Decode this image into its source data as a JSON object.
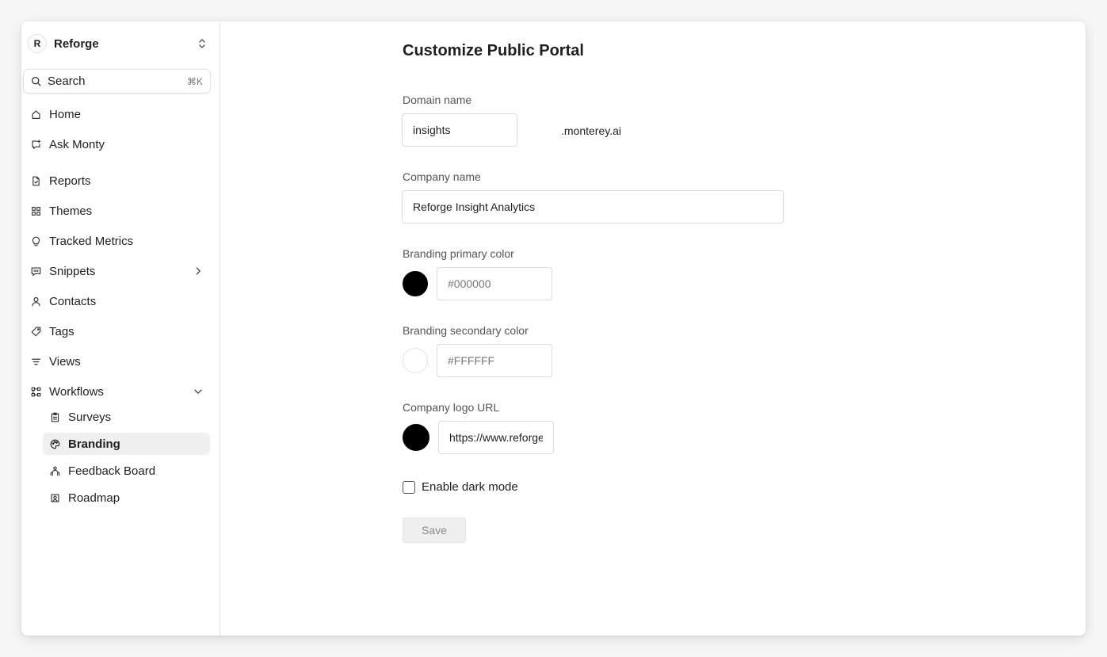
{
  "workspace": {
    "initial": "R",
    "name": "Reforge"
  },
  "search": {
    "label": "Search",
    "shortcut": "⌘K"
  },
  "nav": {
    "home": "Home",
    "ask_monty": "Ask Monty",
    "reports": "Reports",
    "themes": "Themes",
    "tracked_metrics": "Tracked Metrics",
    "snippets": "Snippets",
    "contacts": "Contacts",
    "tags": "Tags",
    "views": "Views",
    "workflows": "Workflows",
    "workflows_children": {
      "surveys": "Surveys",
      "branding": "Branding",
      "feedback_board": "Feedback Board",
      "roadmap": "Roadmap"
    },
    "active_item": "Branding"
  },
  "form": {
    "title": "Customize Public Portal",
    "domain": {
      "label": "Domain name",
      "value": "insights",
      "suffix": ".monterey.ai"
    },
    "company_name": {
      "label": "Company name",
      "value": "Reforge Insight Analytics"
    },
    "primary_color": {
      "label": "Branding primary color",
      "value": "#000000",
      "swatch": "#000000"
    },
    "secondary_color": {
      "label": "Branding secondary color",
      "value": "#FFFFFF",
      "swatch": "#FFFFFF"
    },
    "logo_url": {
      "label": "Company logo URL",
      "value": "https://www.reforge.com"
    },
    "dark_mode": {
      "label": "Enable dark mode",
      "checked": false
    },
    "save_label": "Save"
  }
}
